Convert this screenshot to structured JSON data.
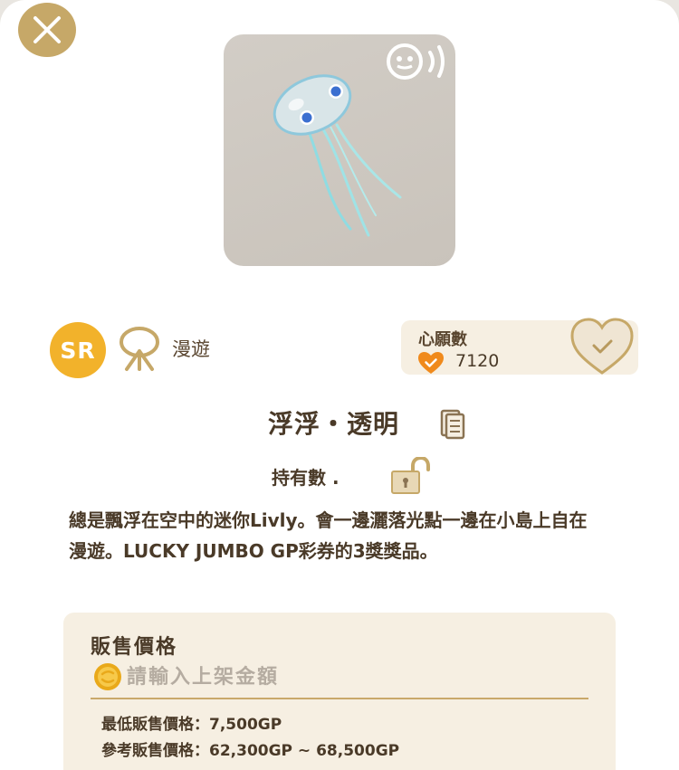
{
  "header": {
    "close_label": "close"
  },
  "item": {
    "rarity": "SR",
    "motion_type": "漫遊",
    "name": "浮浮・透明",
    "owned_label": "持有數 .",
    "description": "總是飄浮在空中的迷你Livly。會一邊灑落光點一邊在小島上自在漫遊。LUCKY JUMBO GP彩券的3獎獎品。"
  },
  "wishlist": {
    "title": "心願數",
    "count": "7120"
  },
  "sale": {
    "title": "販售價格",
    "input_placeholder": "請輸入上架金額",
    "input_value": "",
    "min_price": "最低販售價格：7,500GP",
    "ref_price": "參考販售價格：62,300GP ~ 68,500GP"
  },
  "colors": {
    "accent_gold": "#c6a868",
    "rarity_orange": "#f2b22b",
    "heart_orange": "#f08a1c",
    "panel_bg": "#f6efe2"
  },
  "icons": [
    "close-icon",
    "sound-icon",
    "motion-icon",
    "heart-icon",
    "doc-icon",
    "lock-icon",
    "coin-icon"
  ]
}
